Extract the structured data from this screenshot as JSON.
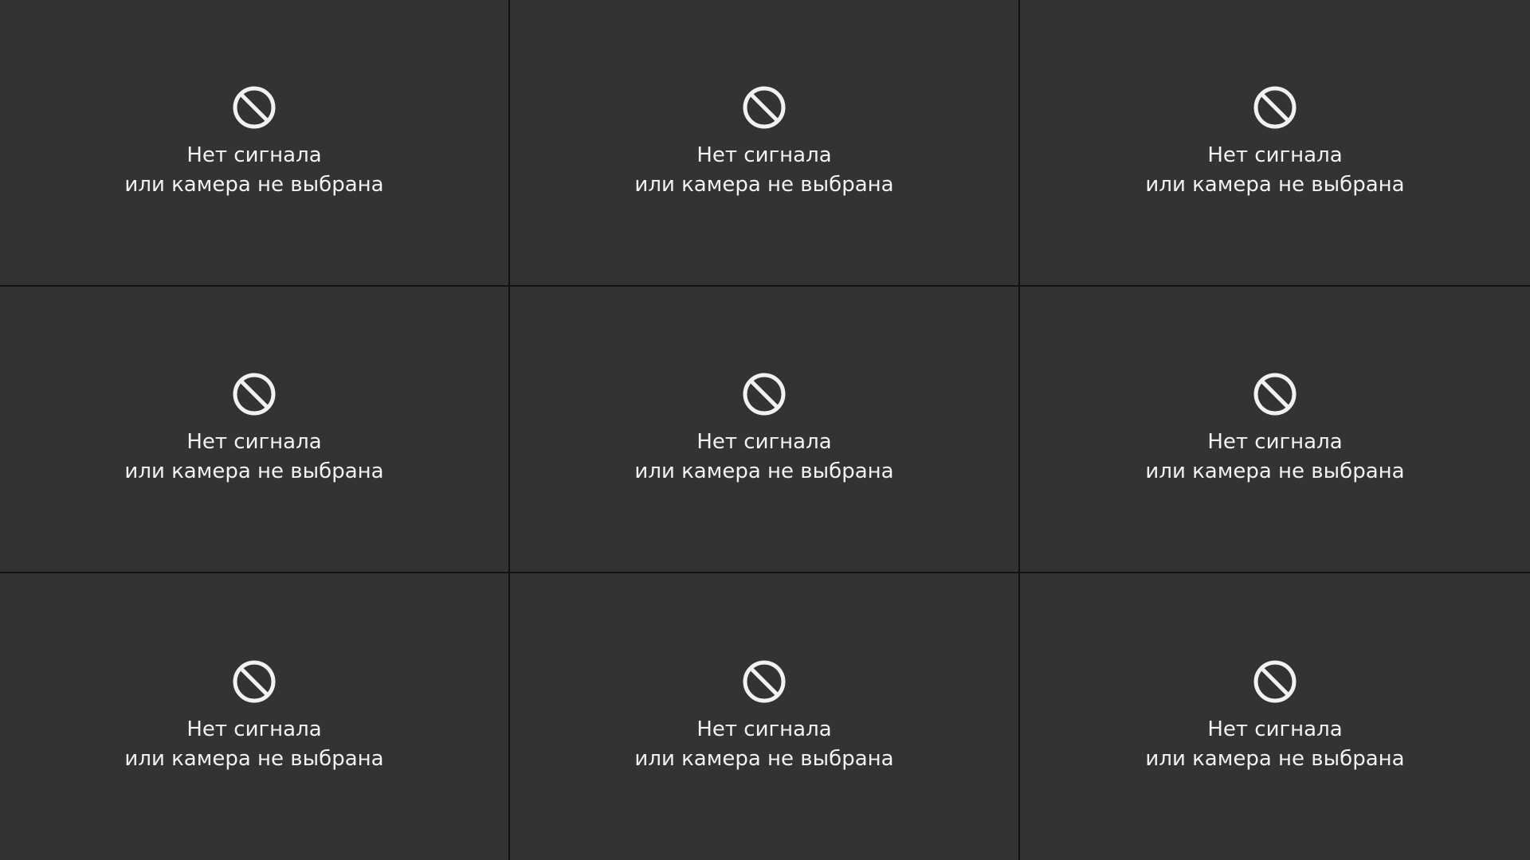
{
  "camera_grid": {
    "icon": "no-signal-icon",
    "colors": {
      "tile_background": "#333333",
      "divider": "#111111",
      "foreground": "#f2f2f2"
    },
    "tiles": [
      {
        "line1": "Нет сигнала",
        "line2": "или камера не выбрана"
      },
      {
        "line1": "Нет сигнала",
        "line2": "или камера не выбрана"
      },
      {
        "line1": "Нет сигнала",
        "line2": "или камера не выбрана"
      },
      {
        "line1": "Нет сигнала",
        "line2": "или камера не выбрана"
      },
      {
        "line1": "Нет сигнала",
        "line2": "или камера не выбрана"
      },
      {
        "line1": "Нет сигнала",
        "line2": "или камера не выбрана"
      },
      {
        "line1": "Нет сигнала",
        "line2": "или камера не выбрана"
      },
      {
        "line1": "Нет сигнала",
        "line2": "или камера не выбрана"
      },
      {
        "line1": "Нет сигнала",
        "line2": "или камера не выбрана"
      }
    ]
  }
}
